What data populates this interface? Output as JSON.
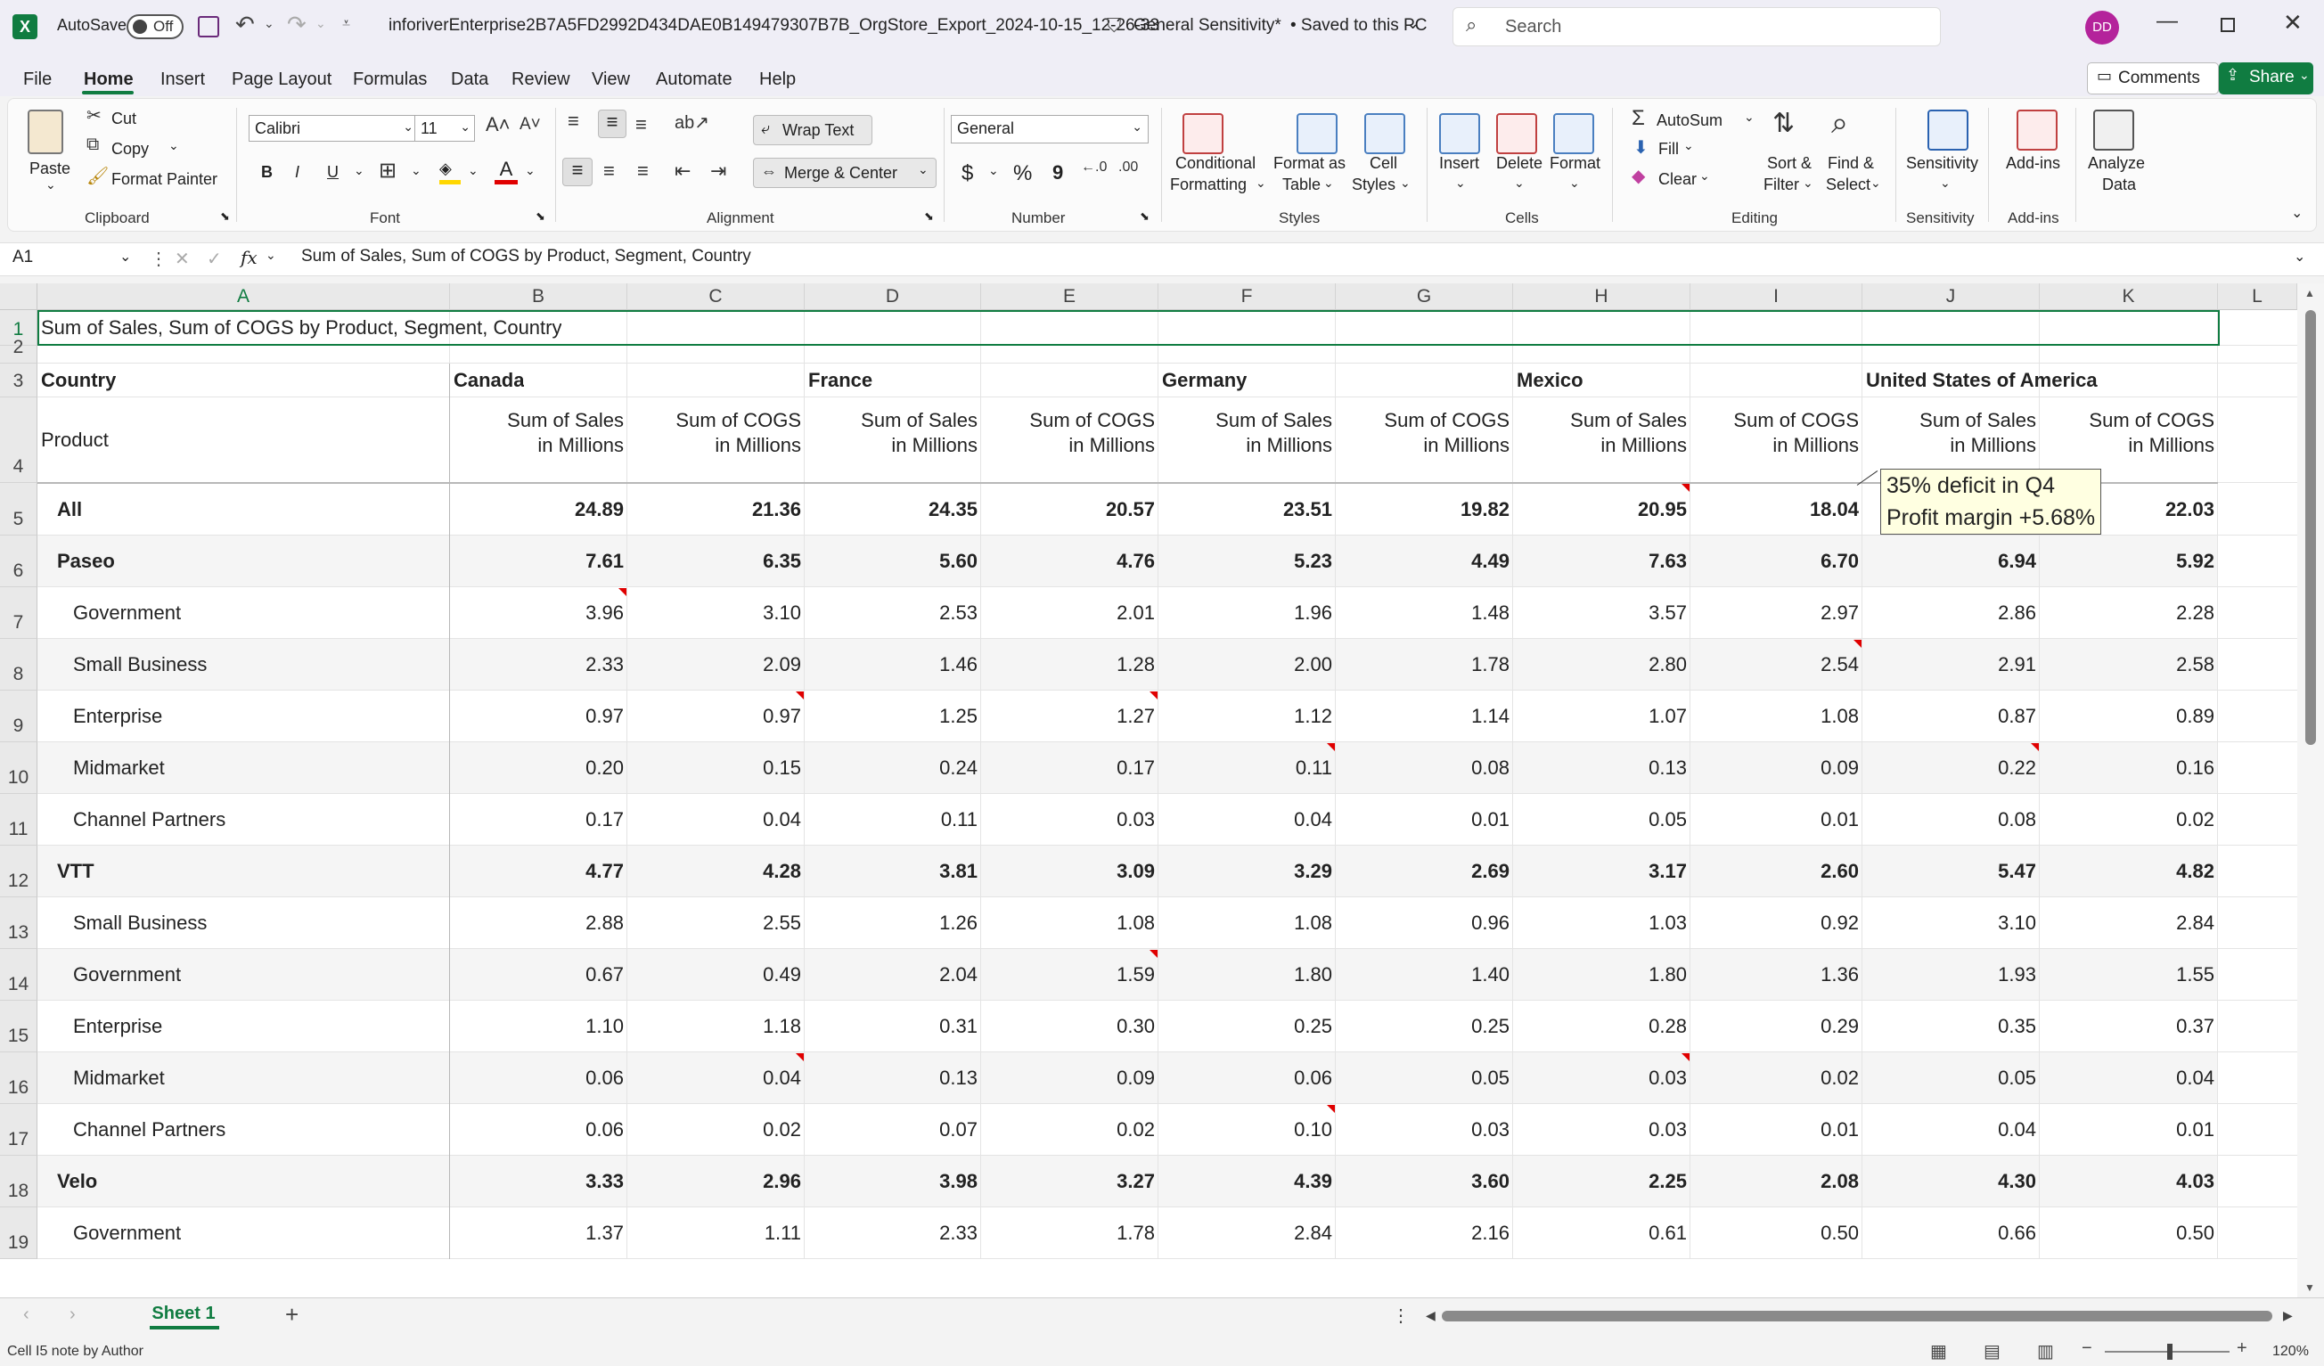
{
  "window": {
    "autosave_label": "AutoSave",
    "autosave_state": "Off",
    "filename": "inforiverEnterprise2B7A5FD2992D434DAE0B149479307B7B_OrgStore_Export_2024-10-15_12-26-33",
    "sensitivity": "General Sensitivity*",
    "save_status": "• Saved to this PC",
    "search_placeholder": "Search",
    "user_initials": "DD"
  },
  "menu": {
    "tabs": [
      "File",
      "Home",
      "Insert",
      "Page Layout",
      "Formulas",
      "Data",
      "Review",
      "View",
      "Automate",
      "Help"
    ],
    "comments": "Comments",
    "share": "Share"
  },
  "ribbon": {
    "clipboard": {
      "paste": "Paste",
      "cut": "Cut",
      "copy": "Copy",
      "format_painter": "Format Painter",
      "label": "Clipboard"
    },
    "font": {
      "name": "Calibri",
      "size": "11",
      "label": "Font",
      "bold": "B",
      "italic": "I",
      "underline": "U"
    },
    "alignment": {
      "wrap_text": "Wrap Text",
      "merge_center": "Merge & Center",
      "label": "Alignment"
    },
    "number": {
      "format": "General",
      "currency": "$",
      "percent": "%",
      "comma": "9",
      "label": "Number"
    },
    "styles": {
      "conditional": "Conditional",
      "formatting": "Formatting",
      "format_as": "Format as",
      "table": "Table",
      "cell": "Cell",
      "cell_styles": "Styles",
      "label": "Styles"
    },
    "cells": {
      "insert": "Insert",
      "delete": "Delete",
      "format": "Format",
      "label": "Cells"
    },
    "editing": {
      "autosum": "AutoSum",
      "fill": "Fill",
      "clear": "Clear",
      "sort": "Sort &",
      "filter": "Filter",
      "find": "Find &",
      "select": "Select",
      "label": "Editing"
    },
    "sensitivity": {
      "button": "Sensitivity",
      "label": "Sensitivity"
    },
    "addins": {
      "button": "Add-ins",
      "label": "Add-ins"
    },
    "analyze": {
      "line1": "Analyze",
      "line2": "Data"
    }
  },
  "formula_bar": {
    "name_box": "A1",
    "fx": "fx",
    "formula": "Sum of  Sales, Sum of COGS by Product, Segment, Country"
  },
  "grid": {
    "columns": [
      "A",
      "B",
      "C",
      "D",
      "E",
      "F",
      "G",
      "H",
      "I",
      "J",
      "K",
      "L"
    ],
    "rows": [
      "1",
      "2",
      "3",
      "4",
      "5",
      "6",
      "7",
      "8",
      "9",
      "10",
      "11",
      "12",
      "13",
      "14",
      "15",
      "16",
      "17",
      "18",
      "19"
    ],
    "title": "Sum of  Sales, Sum of COGS by Product, Segment, Country",
    "country_label": "Country",
    "product_label": "Product",
    "countries": [
      "Canada",
      "France",
      "Germany",
      "Mexico",
      "United States of America"
    ],
    "measure_sales": [
      "Sum of  Sales",
      "in Millions"
    ],
    "measure_cogs": [
      "Sum of COGS",
      "in Millions"
    ],
    "data_rows": [
      {
        "label": "All",
        "level": 0,
        "values": [
          "24.89",
          "21.36",
          "24.35",
          "20.57",
          "23.51",
          "19.82",
          "20.95",
          "18.04",
          "",
          "22.03"
        ]
      },
      {
        "label": "Paseo",
        "level": 0,
        "values": [
          "7.61",
          "6.35",
          "5.60",
          "4.76",
          "5.23",
          "4.49",
          "7.63",
          "6.70",
          "6.94",
          "5.92"
        ]
      },
      {
        "label": "Government",
        "level": 1,
        "values": [
          "3.96",
          "3.10",
          "2.53",
          "2.01",
          "1.96",
          "1.48",
          "3.57",
          "2.97",
          "2.86",
          "2.28"
        ]
      },
      {
        "label": "Small Business",
        "level": 1,
        "values": [
          "2.33",
          "2.09",
          "1.46",
          "1.28",
          "2.00",
          "1.78",
          "2.80",
          "2.54",
          "2.91",
          "2.58"
        ]
      },
      {
        "label": "Enterprise",
        "level": 1,
        "values": [
          "0.97",
          "0.97",
          "1.25",
          "1.27",
          "1.12",
          "1.14",
          "1.07",
          "1.08",
          "0.87",
          "0.89"
        ]
      },
      {
        "label": "Midmarket",
        "level": 1,
        "values": [
          "0.20",
          "0.15",
          "0.24",
          "0.17",
          "0.11",
          "0.08",
          "0.13",
          "0.09",
          "0.22",
          "0.16"
        ]
      },
      {
        "label": "Channel Partners",
        "level": 1,
        "values": [
          "0.17",
          "0.04",
          "0.11",
          "0.03",
          "0.04",
          "0.01",
          "0.05",
          "0.01",
          "0.08",
          "0.02"
        ]
      },
      {
        "label": "VTT",
        "level": 0,
        "values": [
          "4.77",
          "4.28",
          "3.81",
          "3.09",
          "3.29",
          "2.69",
          "3.17",
          "2.60",
          "5.47",
          "4.82"
        ]
      },
      {
        "label": "Small Business",
        "level": 1,
        "values": [
          "2.88",
          "2.55",
          "1.26",
          "1.08",
          "1.08",
          "0.96",
          "1.03",
          "0.92",
          "3.10",
          "2.84"
        ]
      },
      {
        "label": "Government",
        "level": 1,
        "values": [
          "0.67",
          "0.49",
          "2.04",
          "1.59",
          "1.80",
          "1.40",
          "1.80",
          "1.36",
          "1.93",
          "1.55"
        ]
      },
      {
        "label": "Enterprise",
        "level": 1,
        "values": [
          "1.10",
          "1.18",
          "0.31",
          "0.30",
          "0.25",
          "0.25",
          "0.28",
          "0.29",
          "0.35",
          "0.37"
        ]
      },
      {
        "label": "Midmarket",
        "level": 1,
        "values": [
          "0.06",
          "0.04",
          "0.13",
          "0.09",
          "0.06",
          "0.05",
          "0.03",
          "0.02",
          "0.05",
          "0.04"
        ]
      },
      {
        "label": "Channel Partners",
        "level": 1,
        "values": [
          "0.06",
          "0.02",
          "0.07",
          "0.02",
          "0.10",
          "0.03",
          "0.03",
          "0.01",
          "0.04",
          "0.01"
        ]
      },
      {
        "label": "Velo",
        "level": 0,
        "values": [
          "3.33",
          "2.96",
          "3.98",
          "3.27",
          "4.39",
          "3.60",
          "2.25",
          "2.08",
          "4.30",
          "4.03"
        ]
      },
      {
        "label": "Government",
        "level": 1,
        "values": [
          "1.37",
          "1.11",
          "2.33",
          "1.78",
          "2.84",
          "2.16",
          "0.61",
          "0.50",
          "0.66",
          "0.50"
        ]
      }
    ],
    "note_markers": [
      [
        7,
        1
      ],
      [
        9,
        2
      ],
      [
        9,
        4
      ],
      [
        10,
        5
      ],
      [
        10,
        9
      ],
      [
        5,
        7
      ],
      [
        8,
        8
      ],
      [
        14,
        4
      ],
      [
        16,
        2
      ],
      [
        16,
        7
      ],
      [
        17,
        5
      ]
    ],
    "note_tooltip": [
      "35% deficit in Q4",
      "Profit margin +5.68%"
    ]
  },
  "sheet_tabs": [
    "Sheet 1"
  ],
  "status_bar": {
    "text": "Cell I5 note by Author",
    "zoom": "120%"
  },
  "colors": {
    "excel_green": "#107c41",
    "note_red": "#e00000",
    "tooltip_bg": "#ffffe1"
  }
}
